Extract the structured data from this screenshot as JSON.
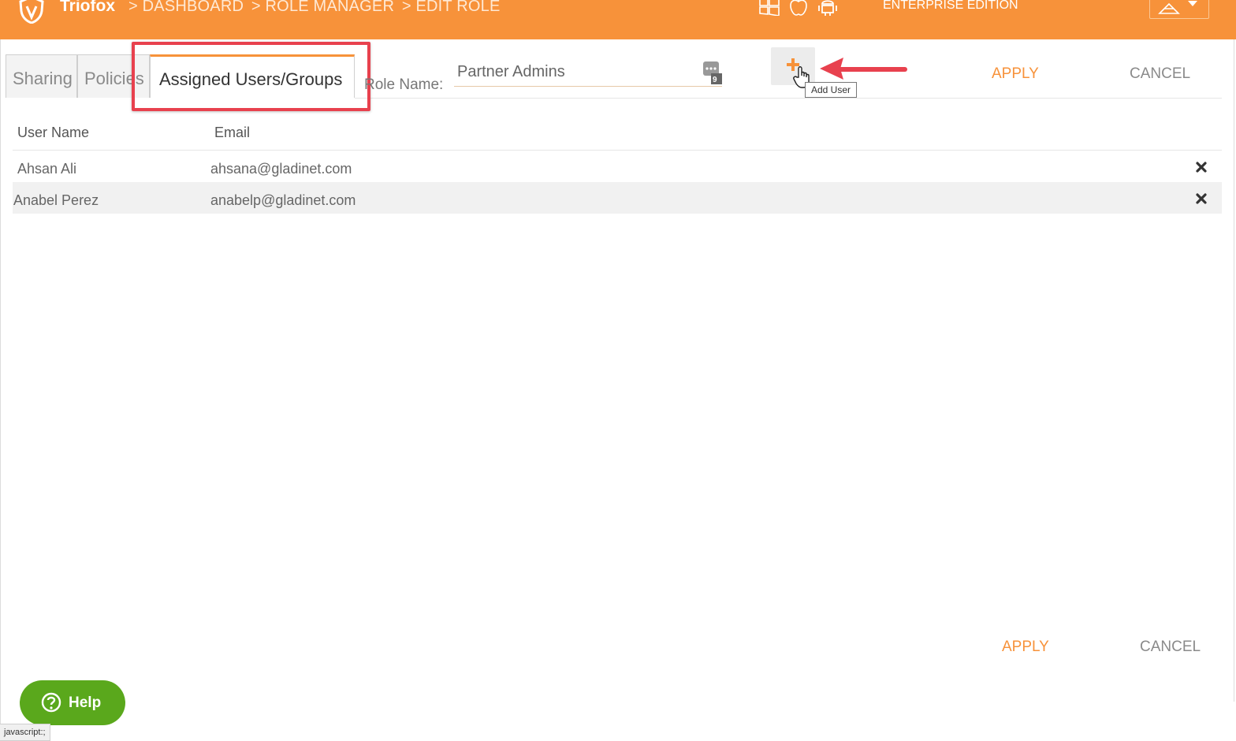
{
  "header": {
    "brand": "Triofox",
    "breadcrumbs": [
      ">  DASHBOARD",
      ">  ROLE MANAGER",
      ">  EDIT ROLE"
    ],
    "os_icons": [
      "windows-icon",
      "apple-icon",
      "android-icon"
    ],
    "edition": "ENTERPRISE EDITION",
    "accent_color": "#f7923a"
  },
  "tabs": [
    {
      "label": "Sharing",
      "active": false
    },
    {
      "label": "Policies",
      "active": false
    },
    {
      "label": "Assigned Users/Groups",
      "active": true
    }
  ],
  "role": {
    "label": "Role Name:",
    "value": "Partner Admins"
  },
  "toolbar": {
    "add_user_tooltip": "Add User",
    "apply_label": "APPLY",
    "cancel_label": "CANCEL"
  },
  "table": {
    "columns": [
      "User Name",
      "Email"
    ],
    "rows": [
      {
        "user": "Ahsan Ali",
        "email": "ahsana@gladinet.com"
      },
      {
        "user": "Anabel Perez",
        "email": "anabelp@gladinet.com"
      }
    ]
  },
  "footer": {
    "apply_label": "APPLY",
    "cancel_label": "CANCEL"
  },
  "help": {
    "label": "Help",
    "color": "#5aa81c"
  },
  "status_bar": "javascript:;"
}
